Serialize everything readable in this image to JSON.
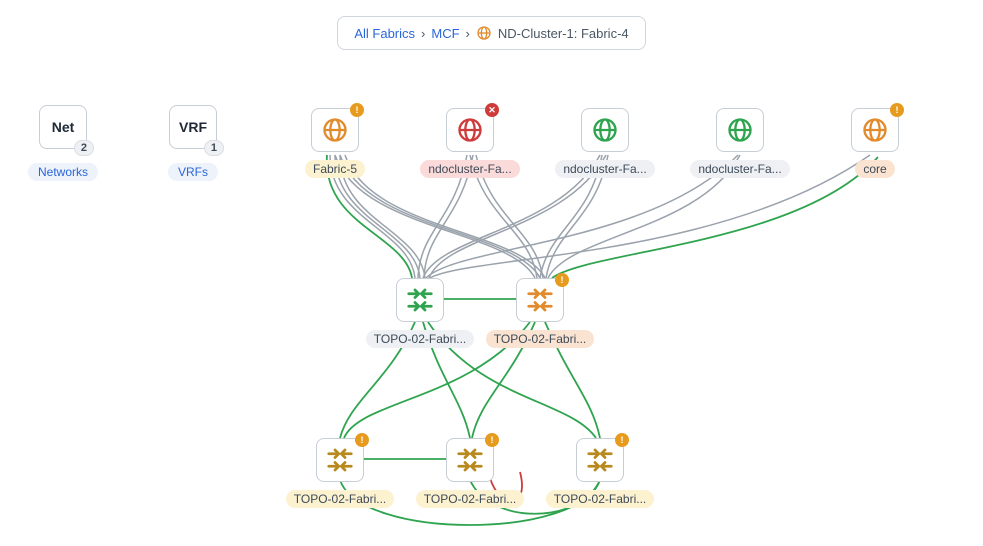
{
  "breadcrumb": {
    "all_fabrics": "All Fabrics",
    "mcf": "MCF",
    "current": "ND-Cluster-1: Fabric-4"
  },
  "side": {
    "net_box": "Net",
    "net_count": "2",
    "net_label": "Networks",
    "vrf_box": "VRF",
    "vrf_count": "1",
    "vrf_label": "VRFs"
  },
  "row1": {
    "n1": "Fabric-5",
    "n2": "ndocluster-Fa...",
    "n3": "ndocluster-Fa...",
    "n4": "ndocluster-Fa...",
    "n5": "core"
  },
  "row2": {
    "n1": "TOPO-02-Fabri...",
    "n2": "TOPO-02-Fabri..."
  },
  "row3": {
    "n1": "TOPO-02-Fabri...",
    "n2": "TOPO-02-Fabri...",
    "n3": "TOPO-02-Fabri..."
  },
  "colors": {
    "orange": "#e28b2d",
    "red": "#cf3a3a",
    "green": "#2fa44f",
    "olive": "#b88a1e"
  },
  "diagram": {
    "type": "network-topology",
    "description": "Fabric topology showing fabric/cluster nodes (row1), two aggregation switches (row2), and three leaf switches (row3) with interconnecting links in grey (inactive/other), green (active/healthy) and red (error)."
  }
}
